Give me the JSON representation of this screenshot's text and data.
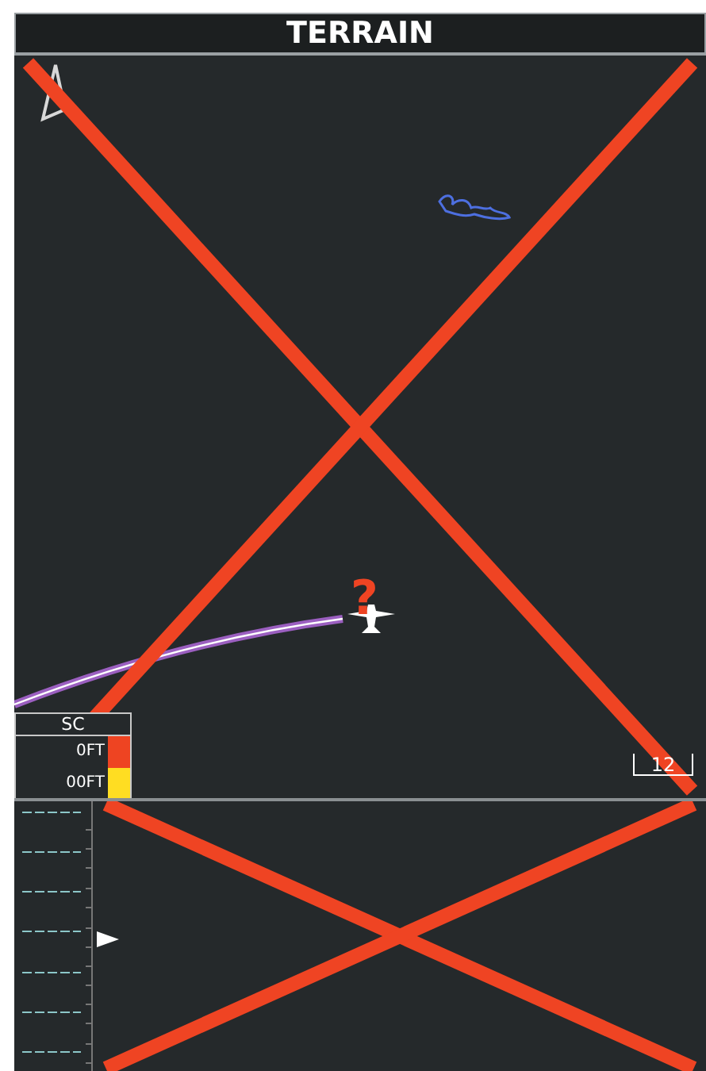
{
  "window": {
    "title": "TERRAIN"
  },
  "legend": {
    "title": "SC",
    "rows": [
      {
        "label": "0FT",
        "color": "#ee4422"
      },
      {
        "label": "00FT",
        "color": "#ffdd22"
      }
    ]
  },
  "scale": {
    "label": "12"
  },
  "failed": true,
  "failure_mark": "?"
}
